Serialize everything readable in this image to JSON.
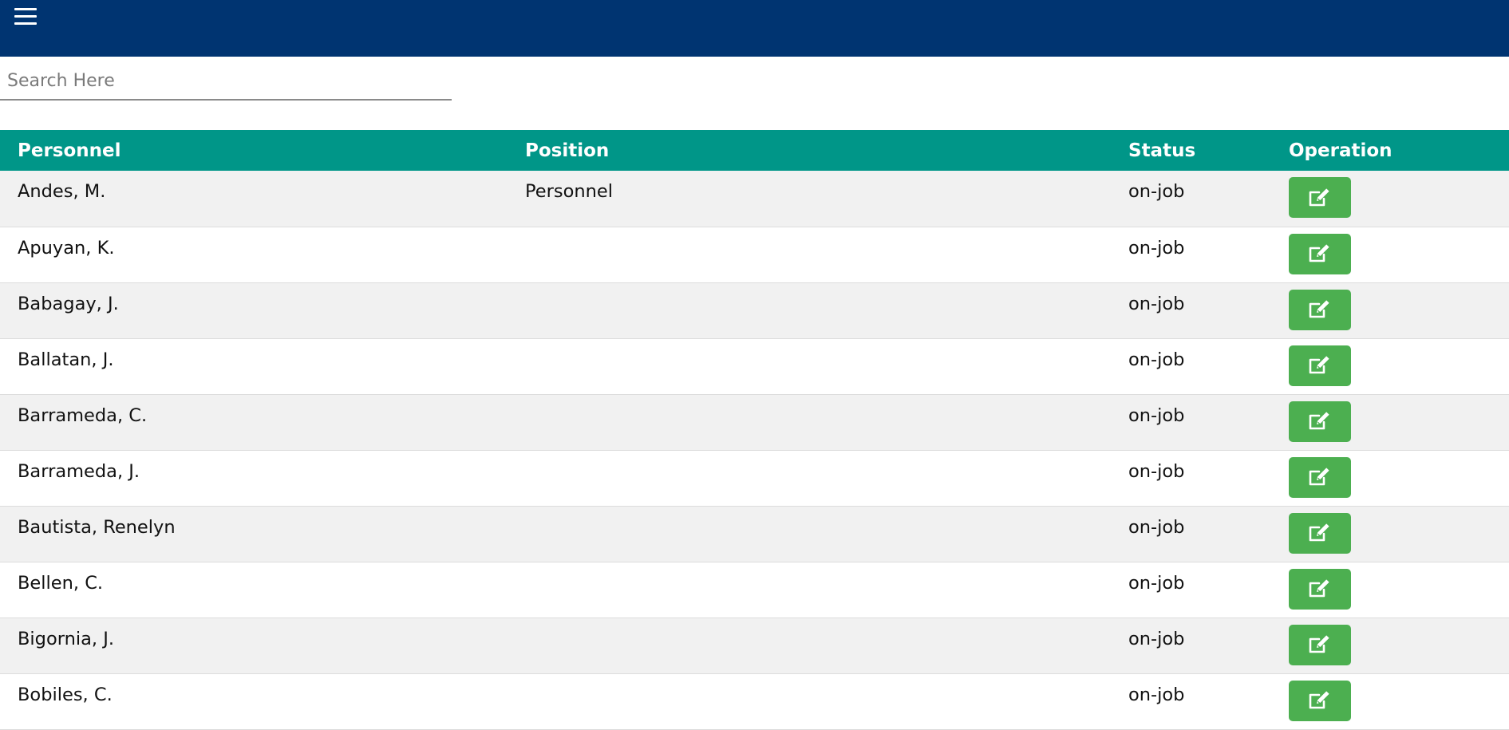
{
  "topbar": {
    "menu_icon": "hamburger-menu-icon",
    "color": "#003471"
  },
  "search": {
    "placeholder": "Search Here",
    "value": ""
  },
  "table": {
    "header_color": "#009688",
    "columns": [
      "Personnel",
      "Position",
      "Status",
      "Operation"
    ],
    "edit_icon": "edit-icon",
    "edit_button_color": "#4caf50",
    "rows": [
      {
        "personnel": "Andes, M.",
        "position": "Personnel",
        "status": "on-job"
      },
      {
        "personnel": "Apuyan, K.",
        "position": "",
        "status": "on-job"
      },
      {
        "personnel": "Babagay, J.",
        "position": "",
        "status": "on-job"
      },
      {
        "personnel": "Ballatan, J.",
        "position": "",
        "status": "on-job"
      },
      {
        "personnel": "Barrameda, C.",
        "position": "",
        "status": "on-job"
      },
      {
        "personnel": "Barrameda, J.",
        "position": "",
        "status": "on-job"
      },
      {
        "personnel": "Bautista, Renelyn",
        "position": "",
        "status": "on-job"
      },
      {
        "personnel": "Bellen, C.",
        "position": "",
        "status": "on-job"
      },
      {
        "personnel": "Bigornia, J.",
        "position": "",
        "status": "on-job"
      },
      {
        "personnel": "Bobiles, C.",
        "position": "",
        "status": "on-job"
      }
    ]
  }
}
